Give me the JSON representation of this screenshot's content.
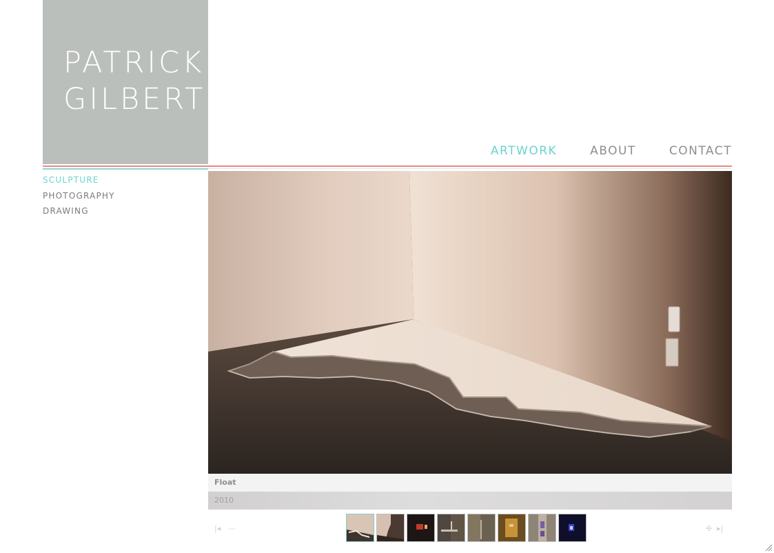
{
  "brand": {
    "line1": "PATRICK",
    "line2": "GILBERT",
    "block_color": "#bbbfbb"
  },
  "main_nav": [
    {
      "label": "ARTWORK",
      "active": true
    },
    {
      "label": "ABOUT",
      "active": false
    },
    {
      "label": "CONTACT",
      "active": false
    }
  ],
  "sub_nav": [
    {
      "label": "SCULPTURE",
      "active": true
    },
    {
      "label": "PHOTOGRAPHY",
      "active": false
    },
    {
      "label": "DRAWING",
      "active": false
    }
  ],
  "artwork": {
    "title": "Float",
    "year": "2010"
  },
  "thumbnails": [
    {
      "icon": "thumbnail-float",
      "active": true
    },
    {
      "icon": "thumbnail-2",
      "active": false
    },
    {
      "icon": "thumbnail-3",
      "active": false
    },
    {
      "icon": "thumbnail-4",
      "active": false
    },
    {
      "icon": "thumbnail-5",
      "active": false
    },
    {
      "icon": "thumbnail-6",
      "active": false
    },
    {
      "icon": "thumbnail-7",
      "active": false
    },
    {
      "icon": "thumbnail-8",
      "active": false
    }
  ],
  "controls": {
    "first_icon": "first-arrow-icon",
    "prev_icon": "prev-dash-icon",
    "next_icon": "next-arrow-icon",
    "last_icon": "last-arrow-icon"
  },
  "colors": {
    "accent": "#6cd3cf",
    "nav_text": "#8e8e8e",
    "rule_red": "#e58a86",
    "rule_teal": "#86d7d3"
  }
}
